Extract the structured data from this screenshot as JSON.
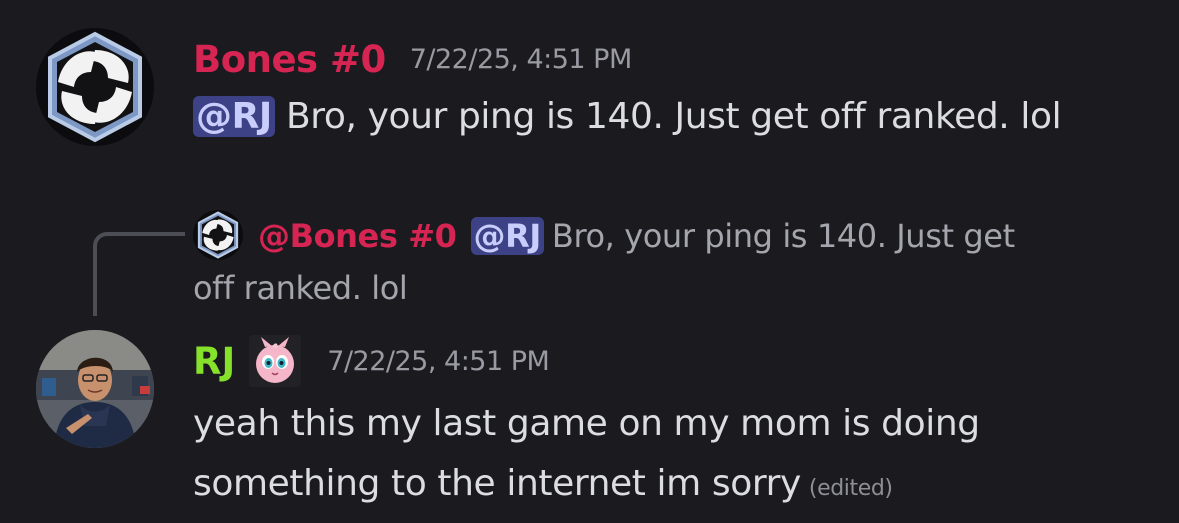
{
  "messages": [
    {
      "author": "Bones #0",
      "timestamp": "7/22/25, 4:51 PM",
      "mention": "@RJ",
      "text": "Bro, your ping is 140. Just get off ranked. lol",
      "author_color": "#d62553",
      "avatar": "spiral-logo-avatar"
    },
    {
      "reply": {
        "author": "@Bones #0",
        "mention": "@RJ",
        "text_line1": "Bro, your ping is 140. Just get",
        "text_line2": "off ranked. lol"
      },
      "author": "RJ",
      "author_color": "#86e12a",
      "role_icon": "jigglypuff-icon",
      "timestamp": "7/22/25, 4:51 PM",
      "text_line1": "yeah this my last game on my mom is doing",
      "text_line2": "something to the internet im sorry",
      "edited_label": "(edited)",
      "avatar": "user-photo-avatar"
    }
  ],
  "colors": {
    "background": "#1b1b1f",
    "mention_bg": "#3d4287",
    "mention_text": "#c9cdfb"
  }
}
